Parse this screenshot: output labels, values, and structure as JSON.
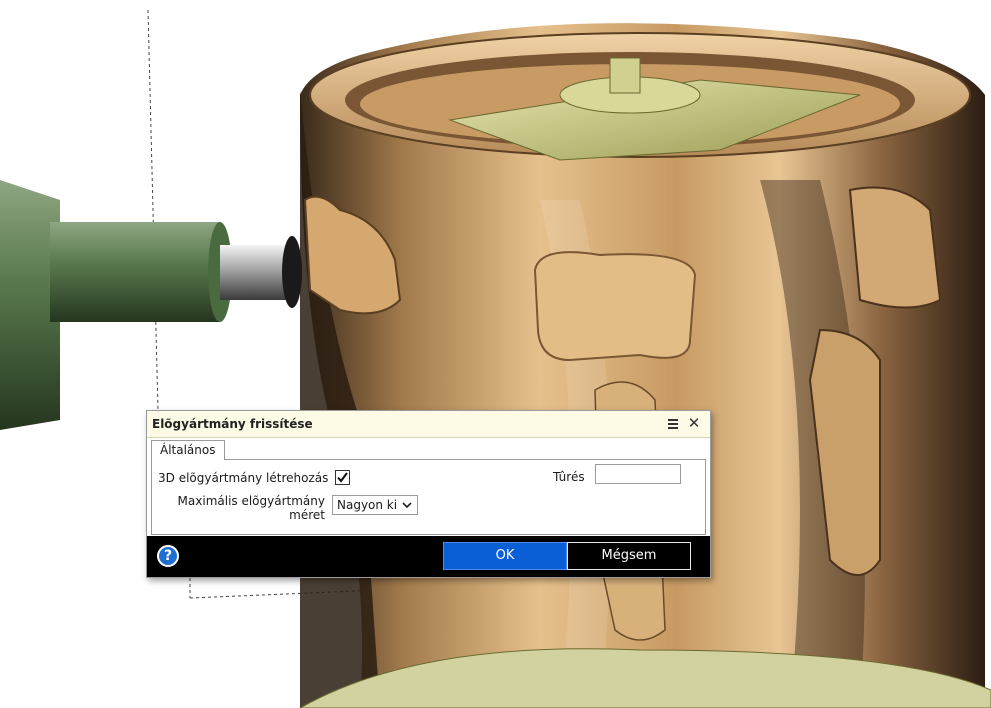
{
  "dialog": {
    "title": "Elõgyártmány frissítése",
    "tabs": [
      {
        "label": "Általános",
        "active": true
      }
    ],
    "fields": {
      "create_3d_label": "3D elõgyártmány létrehozás",
      "create_3d_checked": true,
      "max_size_label_line1": "Maximális elõgyártmány",
      "max_size_label_line2": "méret",
      "max_size_value": "Nagyon ki",
      "tolerance_label": "Tûrés",
      "tolerance_value": ""
    },
    "buttons": {
      "ok": "OK",
      "cancel": "Mégsem"
    },
    "icons": {
      "menu": "menu-icon",
      "close": "close-icon",
      "help": "help-icon",
      "dropdown": "chevron-down-icon"
    },
    "help_glyph": "?",
    "close_glyph": "✕"
  },
  "colors": {
    "titlebar_bg": "#fdfae6",
    "ok_bg": "#0a5fd6",
    "footer_bg": "#000000",
    "model_wood": "#d9b07a",
    "tool_green": "#5a7a4e"
  }
}
